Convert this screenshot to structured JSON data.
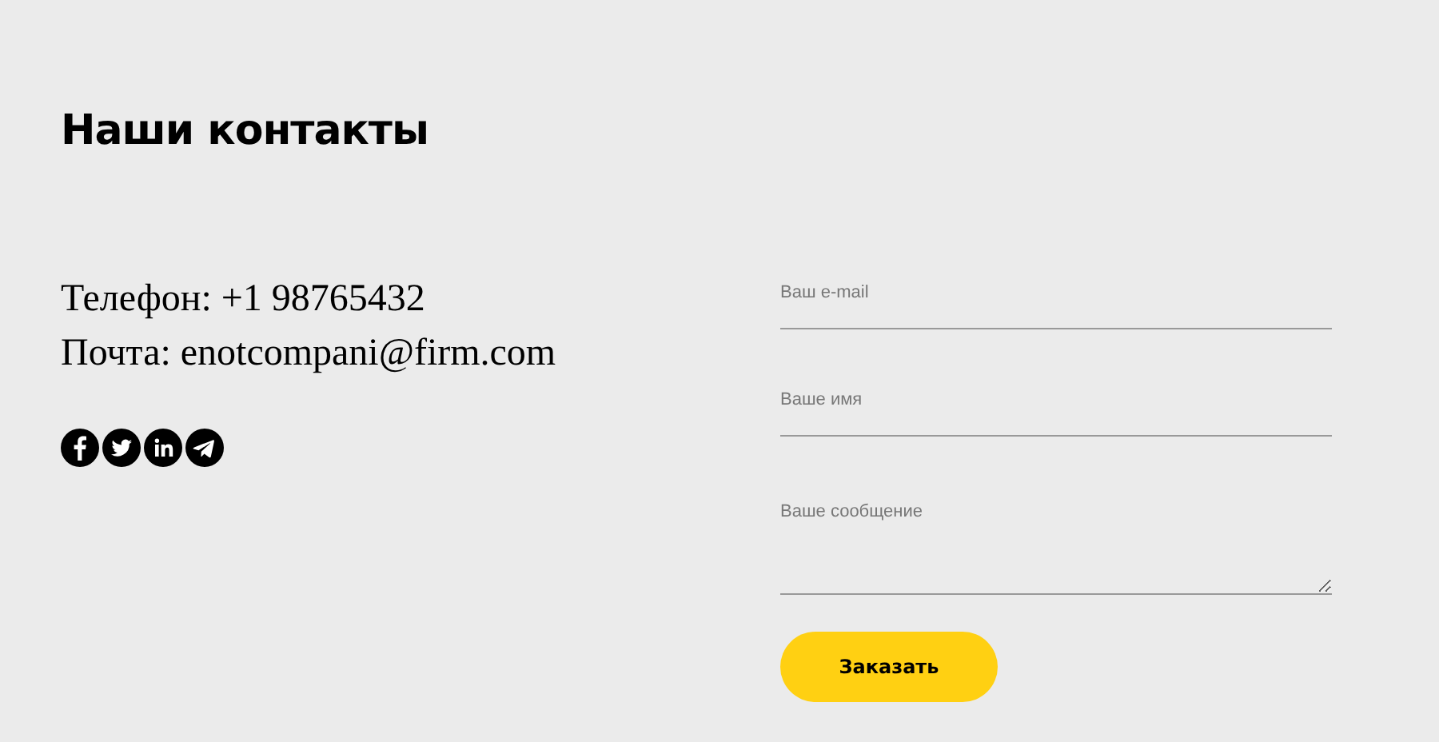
{
  "title": "Наши контакты",
  "contacts": [
    "Телефон: +1 98765432",
    "Почта: enotcompani@firm.com"
  ],
  "social": [
    {
      "kind": "facebook"
    },
    {
      "kind": "twitter"
    },
    {
      "kind": "linkedin"
    },
    {
      "kind": "telegram"
    }
  ],
  "form": {
    "fields": [
      {
        "kind": "input",
        "placeholder": "Ваш e-mail"
      },
      {
        "kind": "input",
        "placeholder": "Ваше имя"
      },
      {
        "kind": "textarea",
        "placeholder": "Ваше сообщение"
      }
    ],
    "submit": "Заказать"
  }
}
